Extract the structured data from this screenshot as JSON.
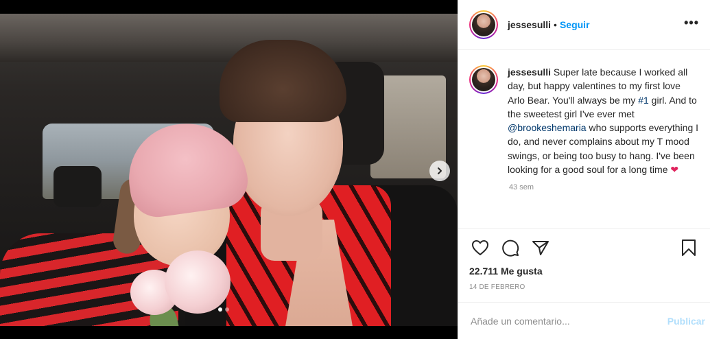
{
  "post": {
    "username": "jessesulli",
    "separator": "•",
    "follow_label": "Seguir",
    "more_label": "•••",
    "carousel": {
      "active_index": 0,
      "count": 2
    }
  },
  "caption": {
    "username": "jessesulli",
    "part1": " Super late because I worked all day, but happy valentines to my first love Arlo Bear. You'll always be my ",
    "hashtag": "#1",
    "part2": " girl. And to the sweetest girl I've ever met ",
    "mention": "@brookeshemaria",
    "part3": " who supports everything I do, and never complains about my T mood swings, or being too busy to hang. I've been looking for a good soul for a long time ",
    "emoji": "❤",
    "time_ago": "43 sem"
  },
  "stats": {
    "likes": "22.711 Me gusta",
    "date": "14 DE FEBRERO"
  },
  "comment_box": {
    "placeholder": "Añade un comentario...",
    "publish_label": "Publicar"
  },
  "icons": {
    "like": "heart-icon",
    "comment": "comment-bubble-icon",
    "share": "paper-plane-icon",
    "save": "bookmark-icon",
    "next": "chevron-right-icon"
  },
  "colors": {
    "link": "#00376b",
    "follow": "#0095f6",
    "publish_disabled": "#b2dffc",
    "heart_emoji": "#e0245e"
  }
}
